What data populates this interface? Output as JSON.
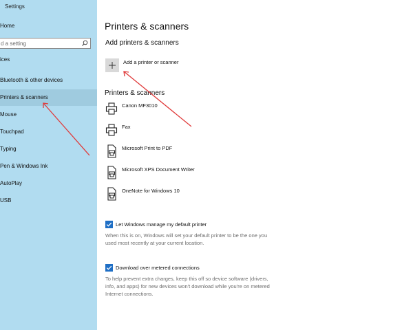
{
  "app": {
    "title": "Settings"
  },
  "sidebar": {
    "home": "Home",
    "search_placeholder": "d a setting",
    "section": "ices",
    "items": [
      {
        "label": "Bluetooth & other devices"
      },
      {
        "label": "Printers & scanners"
      },
      {
        "label": "Mouse"
      },
      {
        "label": "Touchpad"
      },
      {
        "label": "Typing"
      },
      {
        "label": "Pen & Windows Ink"
      },
      {
        "label": "AutoPlay"
      },
      {
        "label": "USB"
      }
    ]
  },
  "main": {
    "title": "Printers & scanners",
    "add_heading": "Add printers & scanners",
    "add_label": "Add a printer or scanner",
    "list_heading": "Printers & scanners",
    "printers": [
      {
        "name": "Canon MF3010",
        "icon": "printer-icon"
      },
      {
        "name": "Fax",
        "icon": "printer-icon"
      },
      {
        "name": "Microsoft Print to PDF",
        "icon": "document-printer-icon"
      },
      {
        "name": "Microsoft XPS Document Writer",
        "icon": "document-printer-icon"
      },
      {
        "name": "OneNote for Windows 10",
        "icon": "document-printer-icon"
      }
    ],
    "default_printer": {
      "label": "Let Windows manage my default printer",
      "checked": true,
      "description": "When this is on, Windows will set your default printer to be the one you used most recently at your current location."
    },
    "metered": {
      "label": "Download over metered connections",
      "checked": true,
      "description": "To help prevent extra charges, keep this off so device software (drivers, info, and apps) for new devices won't download while you're on metered Internet connections."
    }
  },
  "colors": {
    "sidebar_bg": "#b1dcf0",
    "selected_bg": "#9fcbdf",
    "checkbox": "#1f6fc5",
    "annotation_arrow": "#e03a3a"
  }
}
